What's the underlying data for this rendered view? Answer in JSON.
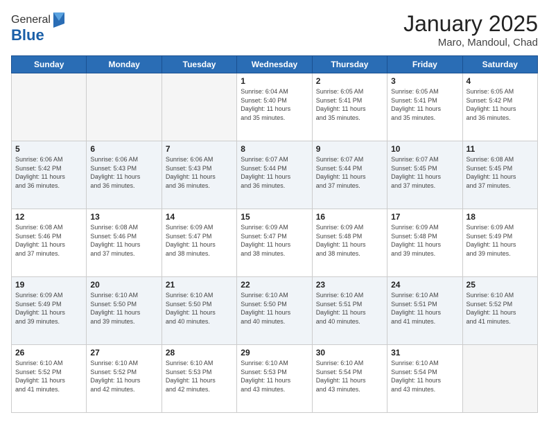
{
  "logo": {
    "general": "General",
    "blue": "Blue"
  },
  "header": {
    "month": "January 2025",
    "location": "Maro, Mandoul, Chad"
  },
  "weekdays": [
    "Sunday",
    "Monday",
    "Tuesday",
    "Wednesday",
    "Thursday",
    "Friday",
    "Saturday"
  ],
  "weeks": [
    [
      {
        "day": "",
        "detail": ""
      },
      {
        "day": "",
        "detail": ""
      },
      {
        "day": "",
        "detail": ""
      },
      {
        "day": "1",
        "detail": "Sunrise: 6:04 AM\nSunset: 5:40 PM\nDaylight: 11 hours\nand 35 minutes."
      },
      {
        "day": "2",
        "detail": "Sunrise: 6:05 AM\nSunset: 5:41 PM\nDaylight: 11 hours\nand 35 minutes."
      },
      {
        "day": "3",
        "detail": "Sunrise: 6:05 AM\nSunset: 5:41 PM\nDaylight: 11 hours\nand 35 minutes."
      },
      {
        "day": "4",
        "detail": "Sunrise: 6:05 AM\nSunset: 5:42 PM\nDaylight: 11 hours\nand 36 minutes."
      }
    ],
    [
      {
        "day": "5",
        "detail": "Sunrise: 6:06 AM\nSunset: 5:42 PM\nDaylight: 11 hours\nand 36 minutes."
      },
      {
        "day": "6",
        "detail": "Sunrise: 6:06 AM\nSunset: 5:43 PM\nDaylight: 11 hours\nand 36 minutes."
      },
      {
        "day": "7",
        "detail": "Sunrise: 6:06 AM\nSunset: 5:43 PM\nDaylight: 11 hours\nand 36 minutes."
      },
      {
        "day": "8",
        "detail": "Sunrise: 6:07 AM\nSunset: 5:44 PM\nDaylight: 11 hours\nand 36 minutes."
      },
      {
        "day": "9",
        "detail": "Sunrise: 6:07 AM\nSunset: 5:44 PM\nDaylight: 11 hours\nand 37 minutes."
      },
      {
        "day": "10",
        "detail": "Sunrise: 6:07 AM\nSunset: 5:45 PM\nDaylight: 11 hours\nand 37 minutes."
      },
      {
        "day": "11",
        "detail": "Sunrise: 6:08 AM\nSunset: 5:45 PM\nDaylight: 11 hours\nand 37 minutes."
      }
    ],
    [
      {
        "day": "12",
        "detail": "Sunrise: 6:08 AM\nSunset: 5:46 PM\nDaylight: 11 hours\nand 37 minutes."
      },
      {
        "day": "13",
        "detail": "Sunrise: 6:08 AM\nSunset: 5:46 PM\nDaylight: 11 hours\nand 37 minutes."
      },
      {
        "day": "14",
        "detail": "Sunrise: 6:09 AM\nSunset: 5:47 PM\nDaylight: 11 hours\nand 38 minutes."
      },
      {
        "day": "15",
        "detail": "Sunrise: 6:09 AM\nSunset: 5:47 PM\nDaylight: 11 hours\nand 38 minutes."
      },
      {
        "day": "16",
        "detail": "Sunrise: 6:09 AM\nSunset: 5:48 PM\nDaylight: 11 hours\nand 38 minutes."
      },
      {
        "day": "17",
        "detail": "Sunrise: 6:09 AM\nSunset: 5:48 PM\nDaylight: 11 hours\nand 39 minutes."
      },
      {
        "day": "18",
        "detail": "Sunrise: 6:09 AM\nSunset: 5:49 PM\nDaylight: 11 hours\nand 39 minutes."
      }
    ],
    [
      {
        "day": "19",
        "detail": "Sunrise: 6:09 AM\nSunset: 5:49 PM\nDaylight: 11 hours\nand 39 minutes."
      },
      {
        "day": "20",
        "detail": "Sunrise: 6:10 AM\nSunset: 5:50 PM\nDaylight: 11 hours\nand 39 minutes."
      },
      {
        "day": "21",
        "detail": "Sunrise: 6:10 AM\nSunset: 5:50 PM\nDaylight: 11 hours\nand 40 minutes."
      },
      {
        "day": "22",
        "detail": "Sunrise: 6:10 AM\nSunset: 5:50 PM\nDaylight: 11 hours\nand 40 minutes."
      },
      {
        "day": "23",
        "detail": "Sunrise: 6:10 AM\nSunset: 5:51 PM\nDaylight: 11 hours\nand 40 minutes."
      },
      {
        "day": "24",
        "detail": "Sunrise: 6:10 AM\nSunset: 5:51 PM\nDaylight: 11 hours\nand 41 minutes."
      },
      {
        "day": "25",
        "detail": "Sunrise: 6:10 AM\nSunset: 5:52 PM\nDaylight: 11 hours\nand 41 minutes."
      }
    ],
    [
      {
        "day": "26",
        "detail": "Sunrise: 6:10 AM\nSunset: 5:52 PM\nDaylight: 11 hours\nand 41 minutes."
      },
      {
        "day": "27",
        "detail": "Sunrise: 6:10 AM\nSunset: 5:52 PM\nDaylight: 11 hours\nand 42 minutes."
      },
      {
        "day": "28",
        "detail": "Sunrise: 6:10 AM\nSunset: 5:53 PM\nDaylight: 11 hours\nand 42 minutes."
      },
      {
        "day": "29",
        "detail": "Sunrise: 6:10 AM\nSunset: 5:53 PM\nDaylight: 11 hours\nand 43 minutes."
      },
      {
        "day": "30",
        "detail": "Sunrise: 6:10 AM\nSunset: 5:54 PM\nDaylight: 11 hours\nand 43 minutes."
      },
      {
        "day": "31",
        "detail": "Sunrise: 6:10 AM\nSunset: 5:54 PM\nDaylight: 11 hours\nand 43 minutes."
      },
      {
        "day": "",
        "detail": ""
      }
    ]
  ]
}
